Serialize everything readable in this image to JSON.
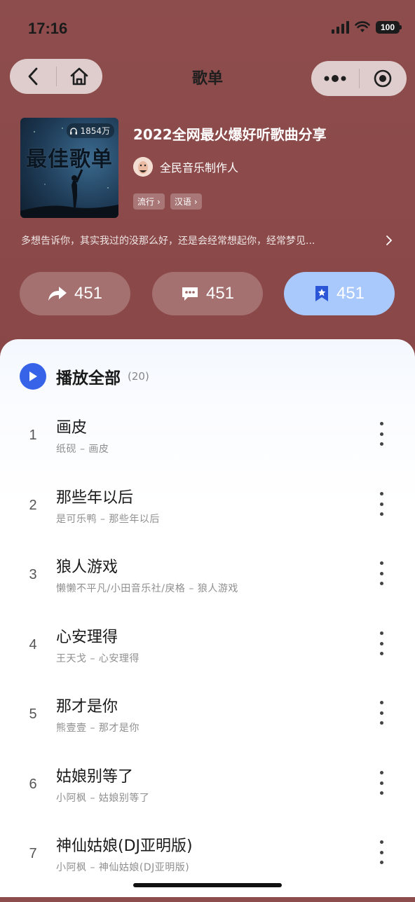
{
  "status": {
    "time": "17:16",
    "battery": "100"
  },
  "nav": {
    "title": "歌单"
  },
  "playlist": {
    "cover_text": "最佳歌单",
    "play_count": "1854万",
    "title": "2022全网最火爆好听歌曲分享",
    "creator": "全民音乐制作人",
    "tags": [
      "流行",
      "汉语"
    ],
    "description": "多想告诉你，其实我过的没那么好，还是会经常想起你，经常梦见..."
  },
  "actions": {
    "share_count": "451",
    "comment_count": "451",
    "collect_count": "451"
  },
  "list": {
    "play_all_label": "播放全部",
    "count": "(20)",
    "songs": [
      {
        "index": "1",
        "title": "画皮",
        "subtitle": "纸砚 – 画皮"
      },
      {
        "index": "2",
        "title": "那些年以后",
        "subtitle": "是可乐鸭 – 那些年以后"
      },
      {
        "index": "3",
        "title": "狼人游戏",
        "subtitle": "懒懒不平凡/小田音乐社/戾格 – 狼人游戏"
      },
      {
        "index": "4",
        "title": "心安理得",
        "subtitle": "王天戈 – 心安理得"
      },
      {
        "index": "5",
        "title": "那才是你",
        "subtitle": "熊壹壹 – 那才是你"
      },
      {
        "index": "6",
        "title": "姑娘别等了",
        "subtitle": "小阿枫 – 姑娘别等了"
      },
      {
        "index": "7",
        "title": "神仙姑娘(DJ亚明版)",
        "subtitle": "小阿枫 – 神仙姑娘(DJ亚明版)"
      }
    ]
  },
  "colors": {
    "accent": "#3663e8",
    "header_bg": "#8e4d4d",
    "collect_bg": "#a9c8fb"
  }
}
